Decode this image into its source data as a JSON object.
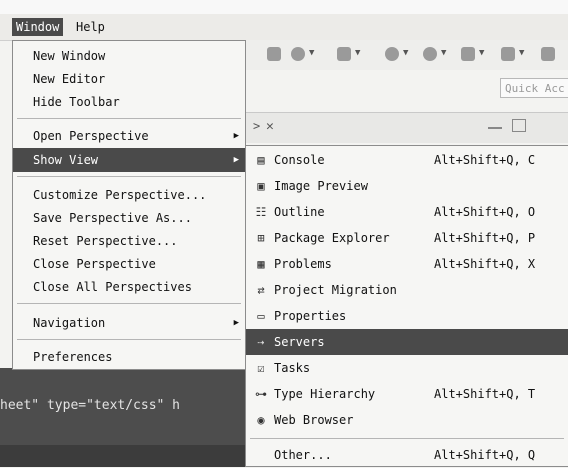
{
  "menubar": {
    "window": "Window",
    "help": "Help"
  },
  "quick_access": {
    "placeholder": "Quick Acc"
  },
  "window_menu": {
    "new_window": "New Window",
    "new_editor": "New Editor",
    "hide_toolbar": "Hide Toolbar",
    "open_perspective": "Open Perspective",
    "show_view": "Show View",
    "customize_perspective": "Customize Perspective...",
    "save_perspective_as": "Save Perspective As...",
    "reset_perspective": "Reset Perspective...",
    "close_perspective": "Close Perspective",
    "close_all_perspectives": "Close All Perspectives",
    "navigation": "Navigation",
    "preferences": "Preferences"
  },
  "show_view_menu": [
    {
      "label": "Console",
      "shortcut": "Alt+Shift+Q, C",
      "icon": "console-icon"
    },
    {
      "label": "Image Preview",
      "shortcut": "",
      "icon": "image-preview-icon"
    },
    {
      "label": "Outline",
      "shortcut": "Alt+Shift+Q, O",
      "icon": "outline-icon"
    },
    {
      "label": "Package Explorer",
      "shortcut": "Alt+Shift+Q, P",
      "icon": "package-explorer-icon"
    },
    {
      "label": "Problems",
      "shortcut": "Alt+Shift+Q, X",
      "icon": "problems-icon"
    },
    {
      "label": "Project Migration",
      "shortcut": "",
      "icon": "project-migration-icon"
    },
    {
      "label": "Properties",
      "shortcut": "",
      "icon": "properties-icon"
    },
    {
      "label": "Servers",
      "shortcut": "",
      "icon": "servers-icon"
    },
    {
      "label": "Tasks",
      "shortcut": "",
      "icon": "tasks-icon"
    },
    {
      "label": "Type Hierarchy",
      "shortcut": "Alt+Shift+Q, T",
      "icon": "type-hierarchy-icon"
    },
    {
      "label": "Web Browser",
      "shortcut": "",
      "icon": "web-browser-icon"
    }
  ],
  "show_view_other": {
    "label": "Other...",
    "shortcut": "Alt+Shift+Q, Q"
  },
  "editor": {
    "code_fragment": "heet\" type=\"text/css\" h"
  },
  "colors": {
    "highlight": "#4a4a4a",
    "menu_bg": "#f6f6f4"
  }
}
